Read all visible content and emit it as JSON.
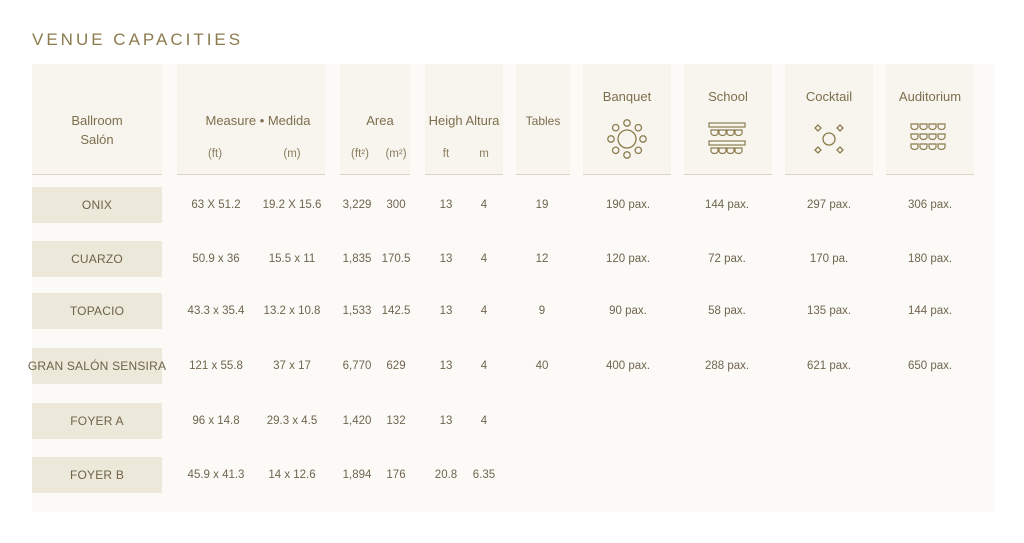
{
  "title": "VENUE CAPACITIES",
  "headers": {
    "ballroom_line1": "Ballroom",
    "ballroom_line2": "Salón",
    "measure": "Measure • Medida",
    "measure_ft": "(ft)",
    "measure_m": "(m)",
    "area": "Area",
    "area_ft2": "(ft²)",
    "area_m2": "(m²)",
    "height": "Heigh Altura",
    "height_ft": "ft",
    "height_m": "m",
    "tables": "Tables",
    "banquet": "Banquet",
    "school": "School",
    "cocktail": "Cocktail",
    "auditorium": "Auditorium"
  },
  "icons": {
    "banquet": "round-table-icon",
    "school": "classroom-desks-icon",
    "cocktail": "cocktail-tables-icon",
    "auditorium": "auditorium-seats-icon"
  },
  "colors": {
    "title": "#8c7b4e",
    "venue_cell": "#ece8da",
    "header_bg": "#f7f5ee",
    "icon": "#8c7b4e"
  },
  "rows": [
    {
      "venue": "ONIX",
      "measure_ft": "63 X 51.2",
      "measure_m": "19.2 X 15.6",
      "area_ft2": "3,229",
      "area_m2": "300",
      "height_ft": "13",
      "height_m": "4",
      "tables": "19",
      "banquet": "190 pax.",
      "school": "144 pax.",
      "cocktail": "297 pax.",
      "auditorium": "306 pax."
    },
    {
      "venue": "CUARZO",
      "measure_ft": "50.9 x 36",
      "measure_m": "15.5 x 11",
      "area_ft2": "1,835",
      "area_m2": "170.5",
      "height_ft": "13",
      "height_m": "4",
      "tables": "12",
      "banquet": "120 pax.",
      "school": "72 pax.",
      "cocktail": "170 pa.",
      "auditorium": "180 pax."
    },
    {
      "venue": "TOPACIO",
      "measure_ft": "43.3 x 35.4",
      "measure_m": "13.2 x 10.8",
      "area_ft2": "1,533",
      "area_m2": "142.5",
      "height_ft": "13",
      "height_m": "4",
      "tables": "9",
      "banquet": "90 pax.",
      "school": "58 pax.",
      "cocktail": "135 pax.",
      "auditorium": "144 pax."
    },
    {
      "venue": "GRAN SALÓN SENSIRA",
      "measure_ft": "121 x 55.8",
      "measure_m": "37 x 17",
      "area_ft2": "6,770",
      "area_m2": "629",
      "height_ft": "13",
      "height_m": "4",
      "tables": "40",
      "banquet": "400 pax.",
      "school": "288 pax.",
      "cocktail": "621 pax.",
      "auditorium": "650 pax."
    },
    {
      "venue": "FOYER A",
      "measure_ft": "96 x 14.8",
      "measure_m": "29.3 x 4.5",
      "area_ft2": "1,420",
      "area_m2": "132",
      "height_ft": "13",
      "height_m": "4",
      "tables": "",
      "banquet": "",
      "school": "",
      "cocktail": "",
      "auditorium": ""
    },
    {
      "venue": "FOYER B",
      "measure_ft": "45.9 x 41.3",
      "measure_m": "14 x 12.6",
      "area_ft2": "1,894",
      "area_m2": "176",
      "height_ft": "20.8",
      "height_m": "6.35",
      "tables": "",
      "banquet": "",
      "school": "",
      "cocktail": "",
      "auditorium": ""
    }
  ]
}
